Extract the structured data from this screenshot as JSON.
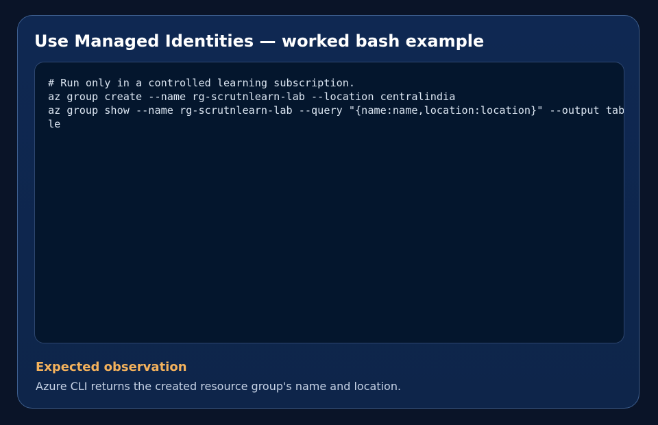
{
  "card": {
    "title": "Use Managed Identities — worked bash example",
    "code": {
      "lines": [
        "# Run only in a controlled learning subscription.",
        "az group create --name rg-scrutnlearn-lab --location centralindia",
        "az group show --name rg-scrutnlearn-lab --query \"{name:name,location:location}\" --output tab",
        "le"
      ]
    },
    "observation": {
      "heading": "Expected observation",
      "text": "Azure CLI returns the created resource group's name and location."
    }
  },
  "colors": {
    "page_background": "#0a1428",
    "card_background": "#0f2852",
    "card_border": "#3e5f8f",
    "code_background": "#04162d",
    "title_text": "#ffffff",
    "code_text": "#dce6f2",
    "observation_heading": "#f4b25c",
    "observation_text": "#c7d3e6"
  }
}
